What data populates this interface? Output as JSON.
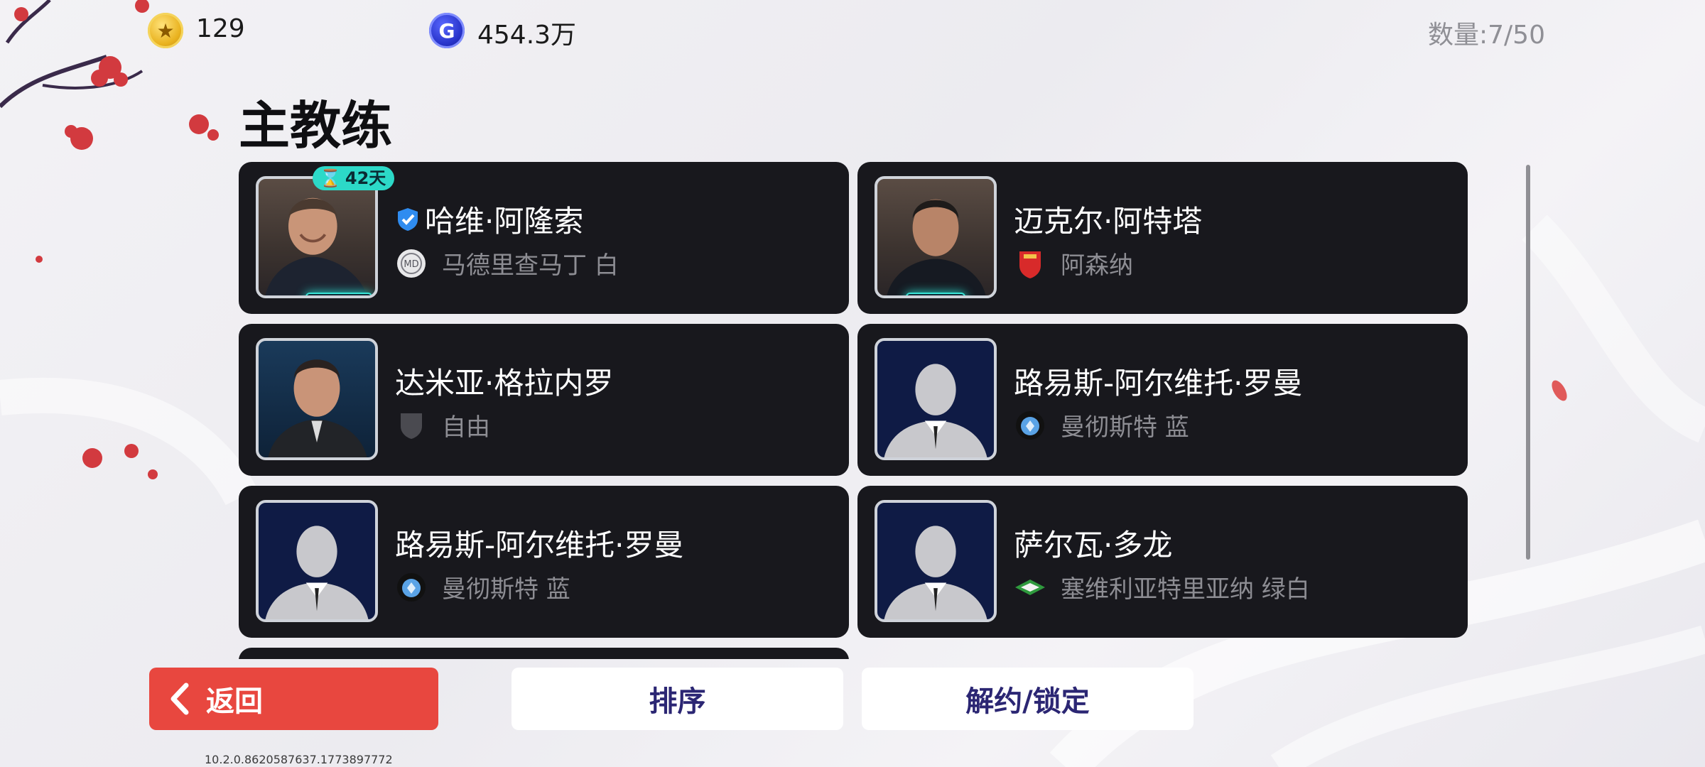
{
  "currency": {
    "gp_value": "129",
    "gc_icon_letter": "G",
    "gc_value": "454.3万"
  },
  "count_label": "数量:7/50",
  "page_title": "主教练",
  "coaches": [
    {
      "name": "哈维·阿隆索",
      "club": "马德里查马丁 白",
      "verified": true,
      "badge_days": "42天",
      "portrait": "photo"
    },
    {
      "name": "迈克尔·阿特塔",
      "club": "阿森纳",
      "verified": false,
      "portrait": "photo"
    },
    {
      "name": "达米亚·格拉内罗",
      "club": "自由",
      "verified": false,
      "portrait": "photo"
    },
    {
      "name": "路易斯-阿尔维托·罗曼",
      "club": "曼彻斯特 蓝",
      "verified": false,
      "portrait": "silhouette"
    },
    {
      "name": "路易斯-阿尔维托·罗曼",
      "club": "曼彻斯特 蓝",
      "verified": false,
      "portrait": "silhouette"
    },
    {
      "name": "萨尔瓦·多龙",
      "club": "塞维利亚特里亚纳 绿白",
      "verified": false,
      "portrait": "silhouette"
    }
  ],
  "buttons": {
    "back": "返回",
    "sort": "排序",
    "release_lock": "解约/锁定"
  },
  "version": "10.2.0.8620587637.1773897772",
  "colors": {
    "back_button": "#e8473f",
    "card_bg": "#18181d",
    "badge": "#2cd9c8",
    "button_text": "#2b2673"
  }
}
